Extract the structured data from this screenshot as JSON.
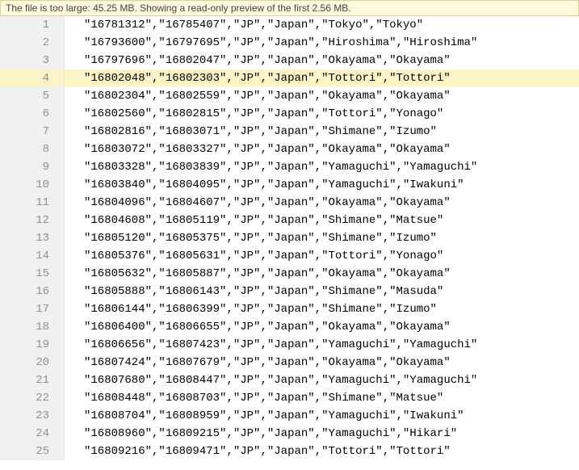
{
  "notice": {
    "prefix": "The file is too large: ",
    "file_size": "45.25 MB",
    "middle": ". Showing a read-only preview of the first ",
    "preview_size": "2.56 MB",
    "suffix": "."
  },
  "highlighted_line": 4,
  "rows": [
    [
      "16781312",
      "16785407",
      "JP",
      "Japan",
      "Tokyo",
      "Tokyo"
    ],
    [
      "16793600",
      "16797695",
      "JP",
      "Japan",
      "Hiroshima",
      "Hiroshima"
    ],
    [
      "16797696",
      "16802047",
      "JP",
      "Japan",
      "Okayama",
      "Okayama"
    ],
    [
      "16802048",
      "16802303",
      "JP",
      "Japan",
      "Tottori",
      "Tottori"
    ],
    [
      "16802304",
      "16802559",
      "JP",
      "Japan",
      "Okayama",
      "Okayama"
    ],
    [
      "16802560",
      "16802815",
      "JP",
      "Japan",
      "Tottori",
      "Yonago"
    ],
    [
      "16802816",
      "16803071",
      "JP",
      "Japan",
      "Shimane",
      "Izumo"
    ],
    [
      "16803072",
      "16803327",
      "JP",
      "Japan",
      "Okayama",
      "Okayama"
    ],
    [
      "16803328",
      "16803839",
      "JP",
      "Japan",
      "Yamaguchi",
      "Yamaguchi"
    ],
    [
      "16803840",
      "16804095",
      "JP",
      "Japan",
      "Yamaguchi",
      "Iwakuni"
    ],
    [
      "16804096",
      "16804607",
      "JP",
      "Japan",
      "Okayama",
      "Okayama"
    ],
    [
      "16804608",
      "16805119",
      "JP",
      "Japan",
      "Shimane",
      "Matsue"
    ],
    [
      "16805120",
      "16805375",
      "JP",
      "Japan",
      "Shimane",
      "Izumo"
    ],
    [
      "16805376",
      "16805631",
      "JP",
      "Japan",
      "Tottori",
      "Yonago"
    ],
    [
      "16805632",
      "16805887",
      "JP",
      "Japan",
      "Okayama",
      "Okayama"
    ],
    [
      "16805888",
      "16806143",
      "JP",
      "Japan",
      "Shimane",
      "Masuda"
    ],
    [
      "16806144",
      "16806399",
      "JP",
      "Japan",
      "Shimane",
      "Izumo"
    ],
    [
      "16806400",
      "16806655",
      "JP",
      "Japan",
      "Okayama",
      "Okayama"
    ],
    [
      "16806656",
      "16807423",
      "JP",
      "Japan",
      "Yamaguchi",
      "Yamaguchi"
    ],
    [
      "16807424",
      "16807679",
      "JP",
      "Japan",
      "Okayama",
      "Okayama"
    ],
    [
      "16807680",
      "16808447",
      "JP",
      "Japan",
      "Yamaguchi",
      "Yamaguchi"
    ],
    [
      "16808448",
      "16808703",
      "JP",
      "Japan",
      "Shimane",
      "Matsue"
    ],
    [
      "16808704",
      "16808959",
      "JP",
      "Japan",
      "Yamaguchi",
      "Iwakuni"
    ],
    [
      "16808960",
      "16809215",
      "JP",
      "Japan",
      "Yamaguchi",
      "Hikari"
    ],
    [
      "16809216",
      "16809471",
      "JP",
      "Japan",
      "Tottori",
      "Tottori"
    ]
  ]
}
